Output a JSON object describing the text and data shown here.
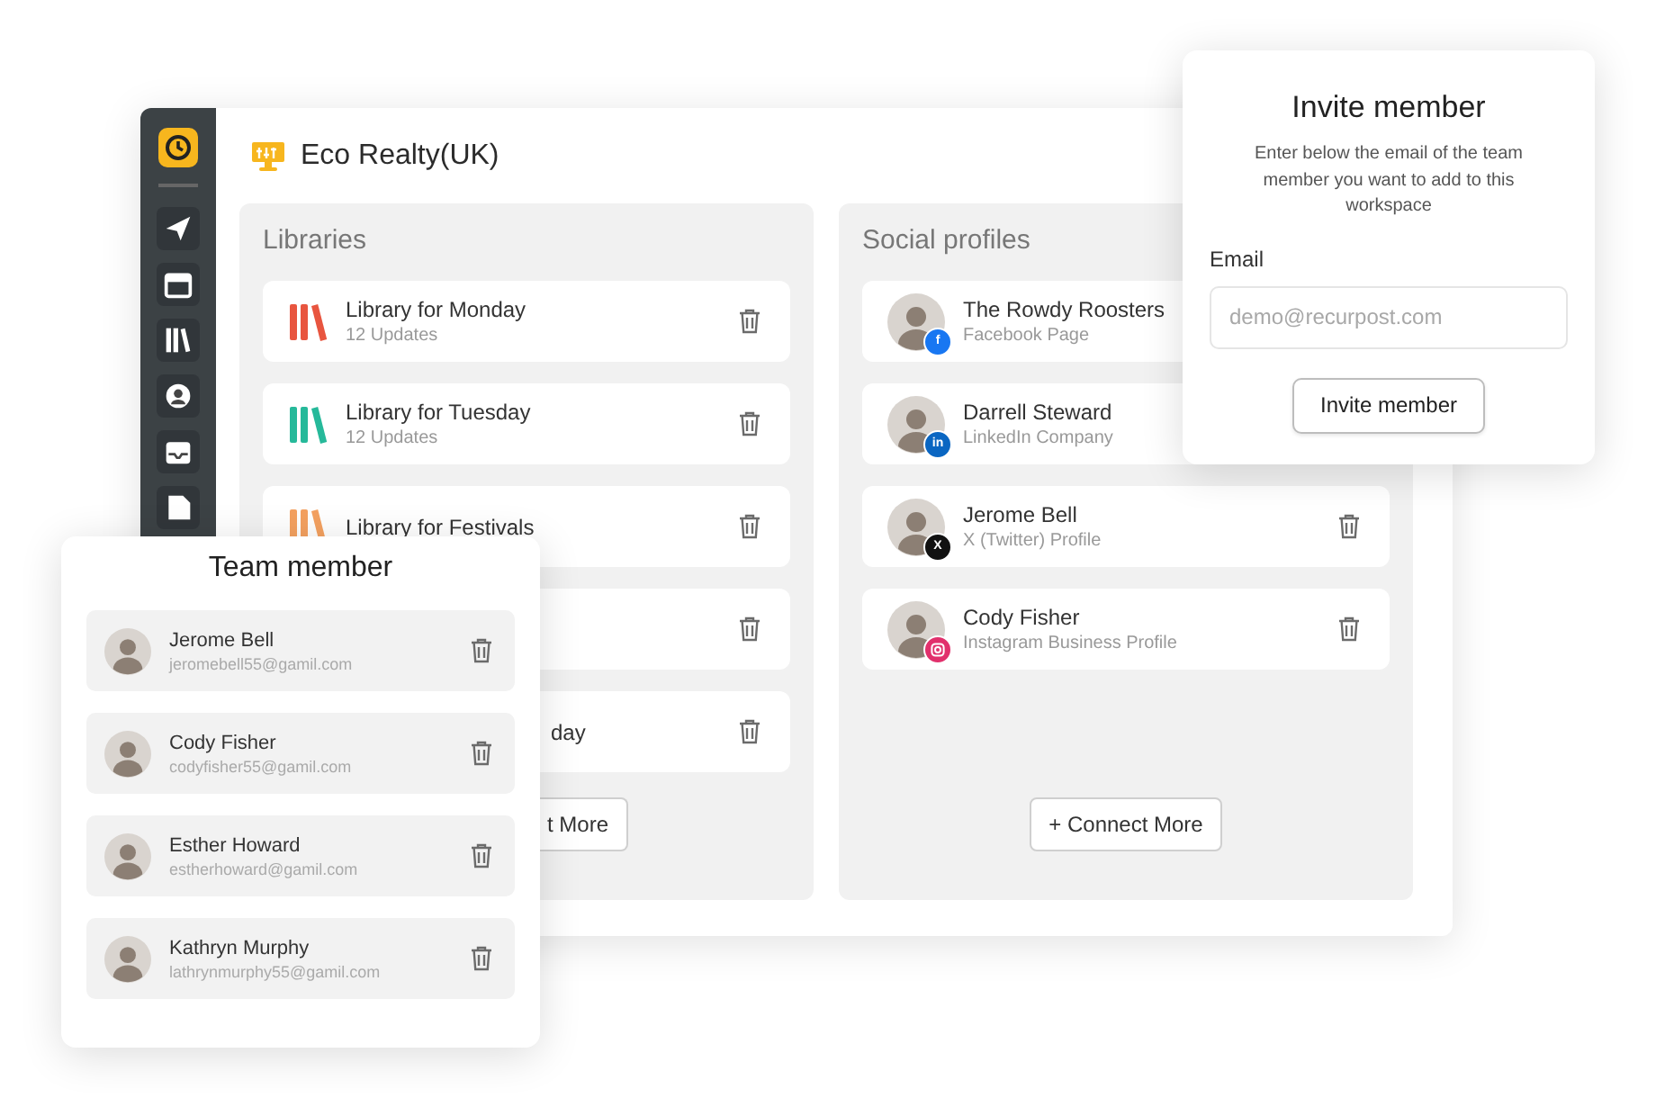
{
  "workspace": {
    "title": "Eco Realty(UK)"
  },
  "libraries": {
    "title": "Libraries",
    "items": [
      {
        "kind": "full",
        "title": "Library for Monday",
        "subtitle": "12 Updates",
        "color": "#e8553f"
      },
      {
        "kind": "full",
        "title": "Library for Tuesday",
        "subtitle": "12 Updates",
        "color": "#26b99a"
      },
      {
        "kind": "full",
        "title": "Library for Festivals",
        "color": "#f4a160"
      },
      {
        "kind": "covered"
      },
      {
        "kind": "covered",
        "title": "day"
      }
    ],
    "button": {
      "label": "t More",
      "clipped": true
    }
  },
  "social_profiles": {
    "title": "Social profiles",
    "items": [
      {
        "name": "The Rowdy Roosters",
        "type": "Facebook Page",
        "kind": "facebook",
        "badge": "f",
        "trash": false
      },
      {
        "name": "Darrell Steward",
        "type": "LinkedIn Company",
        "kind": "linkedin",
        "badge": "in",
        "trash": false
      },
      {
        "name": "Jerome Bell",
        "type": "X (Twitter) Profile",
        "kind": "x",
        "badge": "X",
        "trash": true
      },
      {
        "name": "Cody Fisher",
        "type": "Instagram Business Profile",
        "kind": "instagram",
        "trash": true
      }
    ],
    "button": {
      "label": "+ Connect More",
      "clipped": false
    }
  },
  "invite": {
    "title": "Invite member",
    "description": "Enter below the email of the team member you want to add to this workspace",
    "email_label": "Email",
    "placeholder": "demo@recurpost.com",
    "button": "Invite member"
  },
  "team": {
    "title": "Team member",
    "members": [
      {
        "name": "Jerome Bell",
        "email": "jeromebell55@gamil.com"
      },
      {
        "name": "Cody Fisher",
        "email": "codyfisher55@gamil.com"
      },
      {
        "name": "Esther Howard",
        "email": "estherhoward@gamil.com"
      },
      {
        "name": "Kathryn Murphy",
        "email": "lathrynmurphy55@gamil.com"
      }
    ]
  }
}
